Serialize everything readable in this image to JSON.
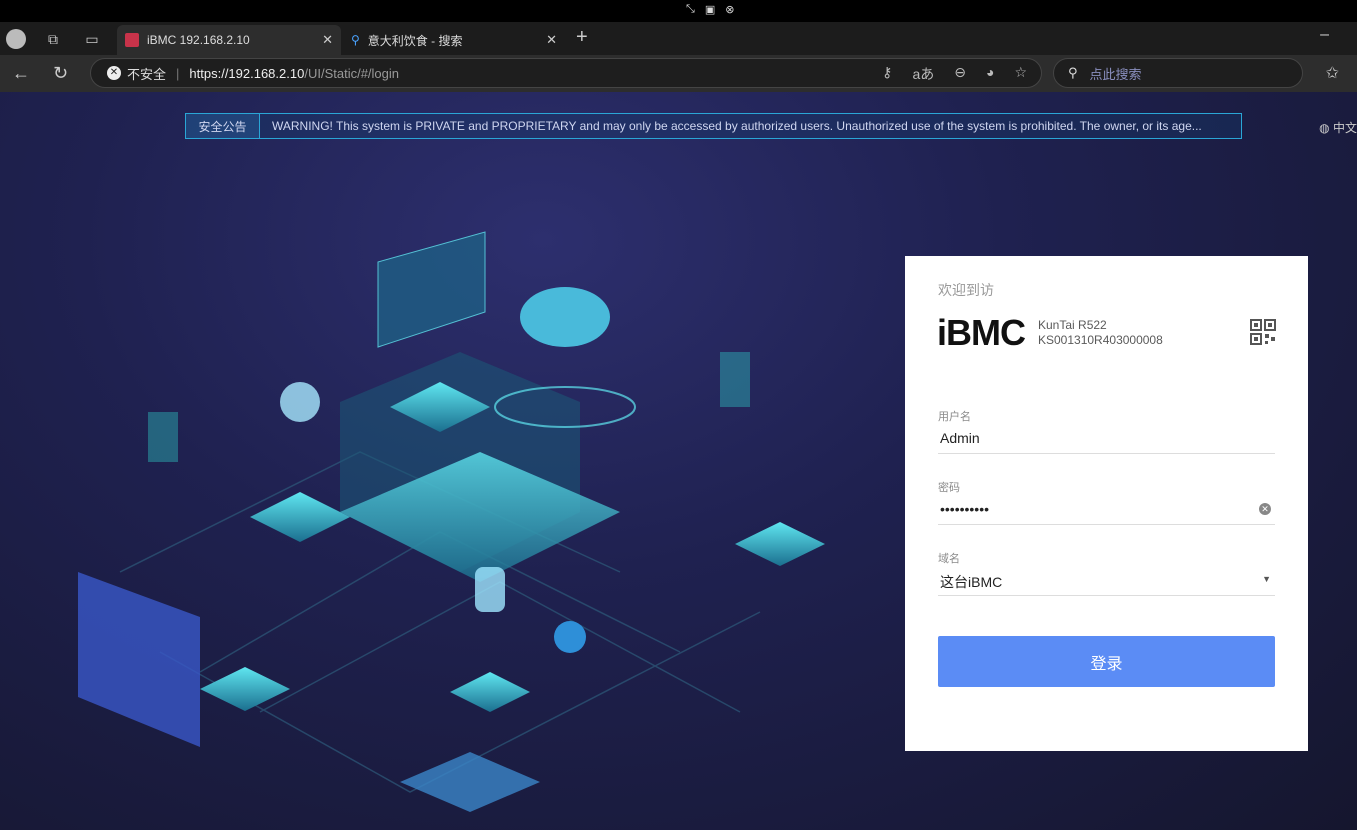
{
  "browser": {
    "tabs": [
      {
        "title": "iBMC 192.168.2.10",
        "active": true
      },
      {
        "title": "意大利饮食 - 搜索",
        "active": false
      }
    ],
    "security_label": "不安全",
    "url_host": "https://192.168.2.10",
    "url_path": "/UI/Static/#/login",
    "search_placeholder": "点此搜索"
  },
  "banner": {
    "label": "安全公告",
    "message": "WARNING! This system is PRIVATE and PROPRIETARY and may only be accessed by authorized users. Unauthorized use of the system is prohibited. The owner, or its age..."
  },
  "language": "中文",
  "login": {
    "welcome": "欢迎到访",
    "logo": "iBMC",
    "model": "KunTai R522",
    "serial": "KS001310R403000008",
    "username_label": "用户名",
    "username_value": "Admin",
    "password_label": "密码",
    "password_value": "••••••••••",
    "domain_label": "域名",
    "domain_value": "这台iBMC",
    "submit": "登录"
  },
  "colors": {
    "accent": "#5b8cf5",
    "banner_border": "#2aa6d6"
  }
}
